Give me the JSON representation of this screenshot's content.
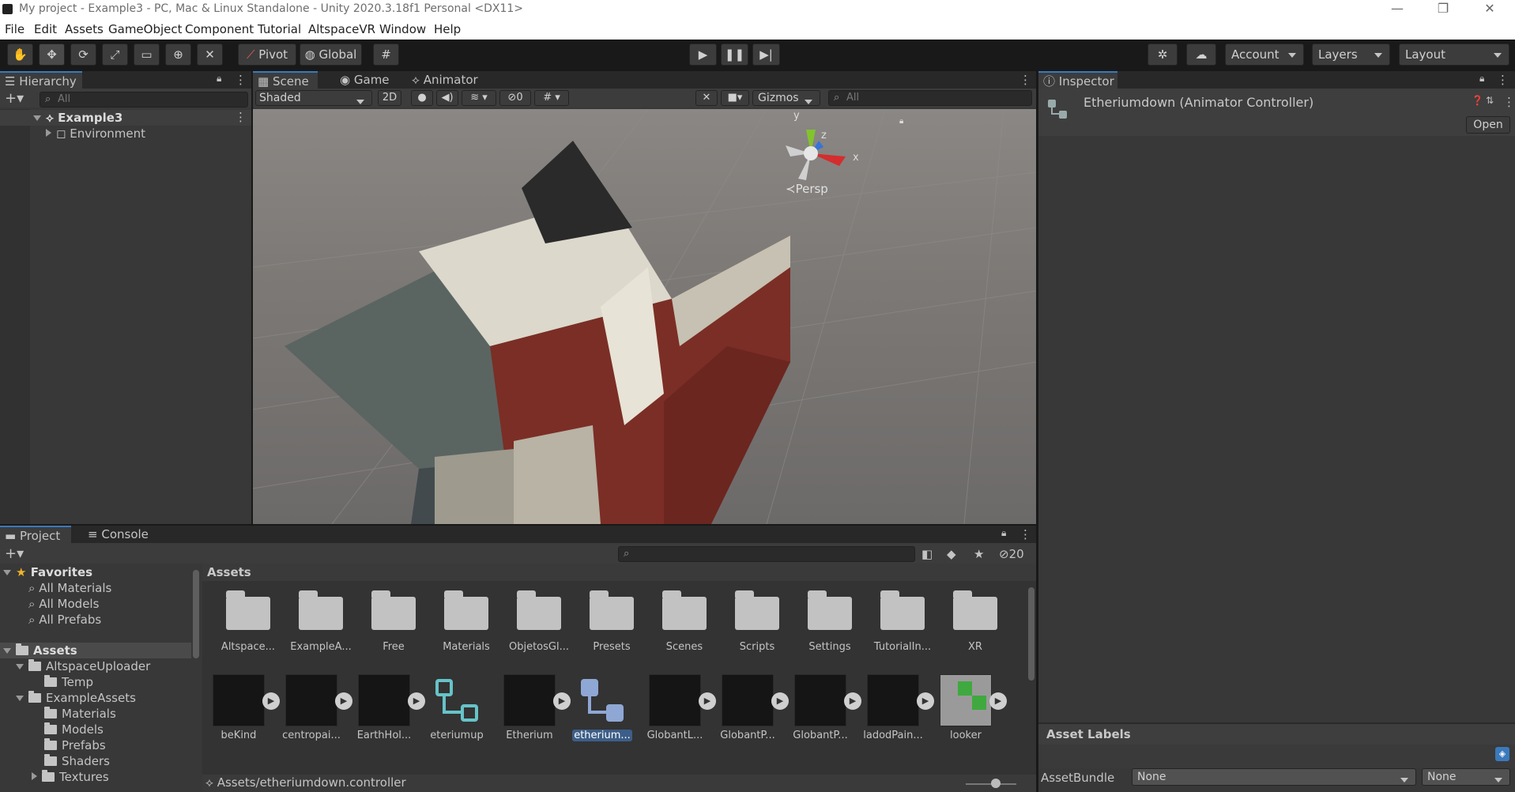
{
  "window": {
    "title": "My project - Example3 - PC, Mac & Linux Standalone - Unity 2020.3.18f1 Personal <DX11>",
    "minimize": "—",
    "maximize": "❐",
    "close": "✕"
  },
  "menu": [
    "File",
    "Edit",
    "Assets",
    "GameObject",
    "Component",
    "Tutorial",
    "AltspaceVR",
    "Window",
    "Help"
  ],
  "toolbar": {
    "pivot": "Pivot",
    "global": "Global",
    "account": "Account",
    "layers": "Layers",
    "layout": "Layout"
  },
  "hierarchy": {
    "tab": "Hierarchy",
    "search_placeholder": "All",
    "scene": "Example3",
    "children": [
      "Environment"
    ]
  },
  "scene_view": {
    "tabs": [
      "Scene",
      "Game",
      "Animator"
    ],
    "shading": "Shaded",
    "mode_2d": "2D",
    "hidden_count": "0",
    "gizmos": "Gizmos",
    "search_placeholder": "All",
    "axis_y": "y",
    "axis_z": "z",
    "axis_x": "x",
    "projection": "Persp"
  },
  "inspector": {
    "tab": "Inspector",
    "object_title": "Etheriumdown (Animator Controller)",
    "open_button": "Open",
    "asset_labels": "Asset Labels",
    "assetbundle_label": "AssetBundle",
    "assetbundle_value": "None",
    "assetbundle_variant": "None"
  },
  "project": {
    "tabs": [
      "Project",
      "Console"
    ],
    "hidden_count": "20",
    "favorites": {
      "label": "Favorites",
      "items": [
        "All Materials",
        "All Models",
        "All Prefabs"
      ]
    },
    "tree": {
      "root": "Assets",
      "altspace": "AltspaceUploader",
      "temp": "Temp",
      "example": "ExampleAssets",
      "example_children": [
        "Materials",
        "Models",
        "Prefabs",
        "Shaders",
        "Textures"
      ]
    },
    "breadcrumb": "Assets",
    "folders": [
      "Altspace...",
      "ExampleA...",
      "Free",
      "Materials",
      "ObjetosGl...",
      "Presets",
      "Scenes",
      "Scripts",
      "Settings",
      "TutorialIn...",
      "XR"
    ],
    "assets": [
      {
        "name": "beKind",
        "icon": "model-thumbnail",
        "play": true
      },
      {
        "name": "centropai...",
        "icon": "model-thumbnail",
        "play": true
      },
      {
        "name": "EarthHol...",
        "icon": "model-thumbnail",
        "play": true
      },
      {
        "name": "eteriumup",
        "icon": "animator-controller-icon",
        "play": false
      },
      {
        "name": "Etherium",
        "icon": "model-thumbnail",
        "play": true
      },
      {
        "name": "etherium...",
        "icon": "animator-controller-icon",
        "play": false,
        "selected": true
      },
      {
        "name": "GlobantL...",
        "icon": "model-thumbnail",
        "play": true
      },
      {
        "name": "GlobantP...",
        "icon": "model-thumbnail",
        "play": true
      },
      {
        "name": "GlobantP...",
        "icon": "model-thumbnail",
        "play": true
      },
      {
        "name": "ladodPain...",
        "icon": "model-thumbnail",
        "play": true
      },
      {
        "name": "looker",
        "icon": "model-thumbnail",
        "play": true
      }
    ],
    "status_path": "Assets/etheriumdown.controller"
  },
  "colors": {
    "accent": "#3a79bb",
    "selection": "#3d5e88",
    "panel": "#383838",
    "controller_icon": "#66c3c8"
  }
}
